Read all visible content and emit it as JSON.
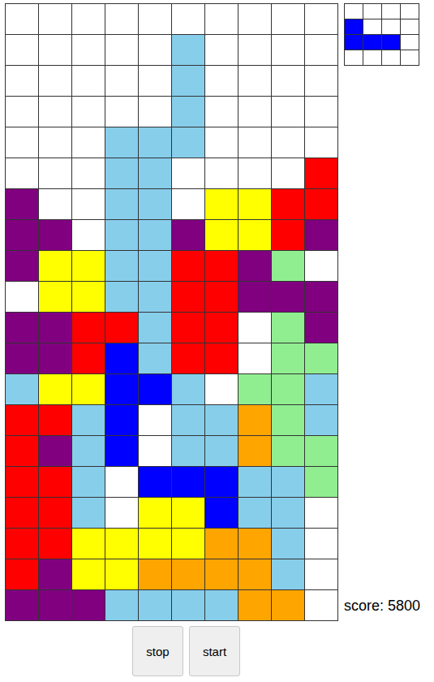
{
  "palette": {
    "W": "#ffffff",
    "L": "#87ceeb",
    "Y": "#ffff00",
    "R": "#ff0000",
    "P": "#800080",
    "G": "#90ee90",
    "B": "#0000ff",
    "O": "#ffa500"
  },
  "board": {
    "rows": [
      "WWWWWWWWWW",
      "WWWWWLWWWW",
      "WWWWWLWWWW",
      "WWWWWLWWWW",
      "WWWLLLWWWW",
      "WWWLLWWWWR",
      "PWWLLWYYRR",
      "PPWLLPYYRP",
      "PYYLLRRPGW",
      "WYYLLRRPPP",
      "PPRRLRRWGP",
      "PPRBLRRWGG",
      "LYYBBLWGGL",
      "RRLBWLLOGL",
      "RPLBWLLOGG",
      "RRLWBBBLLG",
      "RRLWYYBLLW",
      "RRYYYYOOLW",
      "RPYYOOOOLW",
      "PPPLLLLOOW"
    ]
  },
  "next": {
    "rows": [
      "WWWW",
      "BWWW",
      "BBBW",
      "WWWW"
    ]
  },
  "score": "score: 5800",
  "buttons": [
    "stop",
    "start"
  ]
}
